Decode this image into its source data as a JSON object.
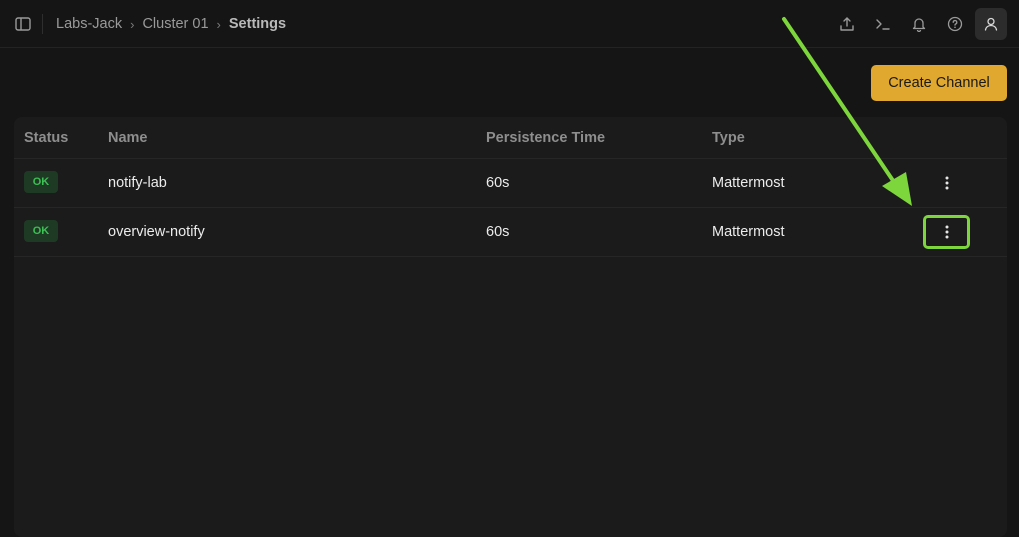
{
  "breadcrumb": {
    "items": [
      "Labs-Jack",
      "Cluster 01"
    ],
    "current": "Settings"
  },
  "topbar": {
    "icons": [
      "upload-icon",
      "terminal-icon",
      "bell-icon",
      "help-icon",
      "user-icon"
    ]
  },
  "actions": {
    "create_label": "Create Channel"
  },
  "table": {
    "headers": {
      "status": "Status",
      "name": "Name",
      "persistence": "Persistence Time",
      "type": "Type"
    },
    "rows": [
      {
        "status": "OK",
        "name": "notify-lab",
        "persistence": "60s",
        "type": "Mattermost"
      },
      {
        "status": "OK",
        "name": "overview-notify",
        "persistence": "60s",
        "type": "Mattermost"
      }
    ]
  },
  "colors": {
    "accent": "#e0a82e",
    "status_ok_bg": "#1f3a24",
    "status_ok_text": "#3cbf55",
    "annotation": "#7dd63c",
    "background": "#151515"
  }
}
